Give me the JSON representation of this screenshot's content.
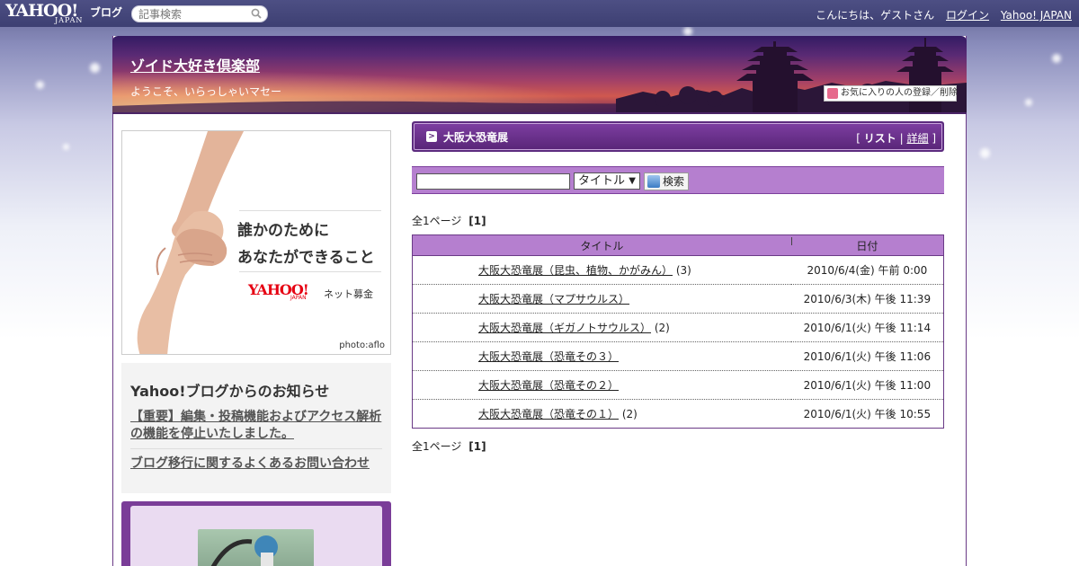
{
  "topbar": {
    "logo_text": "YAHOO!",
    "logo_sub": "JAPAN",
    "logo_blog": "ブログ",
    "search_placeholder": "記事検索",
    "greeting": "こんにちは、ゲストさん",
    "login_label": "ログイン",
    "yahoo_japan_label": "Yahoo! JAPAN"
  },
  "header": {
    "blog_title": "ゾイド大好き倶楽部",
    "blog_description": "ようこそ、いらっしゃいマセー",
    "favorite_button": "お気に入りの人の登録／削除"
  },
  "ad": {
    "line1": "誰かのために",
    "line2": "あなたができること",
    "logo_text": "YAHOO!",
    "logo_sub": "JAPAN",
    "tagline": "ネット募金",
    "credit": "photo:aflo"
  },
  "notice": {
    "title": "Yahoo!ブログからのお知らせ",
    "links": [
      "【重要】編集・投稿機能およびアクセス解析の機能を停止いたしました。",
      "ブログ移行に関するよくあるお問い合わせ"
    ]
  },
  "section": {
    "title": "大阪大恐竜展",
    "view_list": "リスト",
    "view_detail": "詳細",
    "view_open": "[",
    "view_sep": "|",
    "view_close": "]"
  },
  "search": {
    "input_value": "",
    "select_value": "タイトル",
    "button_label": "検索"
  },
  "pager": {
    "label": "全1ページ",
    "current": "[1]"
  },
  "table": {
    "headers": [
      "タイトル",
      "日付"
    ],
    "rows": [
      {
        "title": "大阪大恐竜展（昆虫、植物、かがみん）",
        "count": "(3)",
        "date": "2010/6/4(金) 午前 0:00"
      },
      {
        "title": "大阪大恐竜展（マプサウルス）",
        "count": "",
        "date": "2010/6/3(木) 午後 11:39"
      },
      {
        "title": "大阪大恐竜展（ギガノトサウルス）",
        "count": "(2)",
        "date": "2010/6/1(火) 午後 11:14"
      },
      {
        "title": "大阪大恐竜展（恐竜その３）",
        "count": "",
        "date": "2010/6/1(火) 午後 11:06"
      },
      {
        "title": "大阪大恐竜展（恐竜その２）",
        "count": "",
        "date": "2010/6/1(火) 午後 11:00"
      },
      {
        "title": "大阪大恐竜展（恐竜その１）",
        "count": "(2)",
        "date": "2010/6/1(火) 午後 10:55"
      }
    ]
  }
}
